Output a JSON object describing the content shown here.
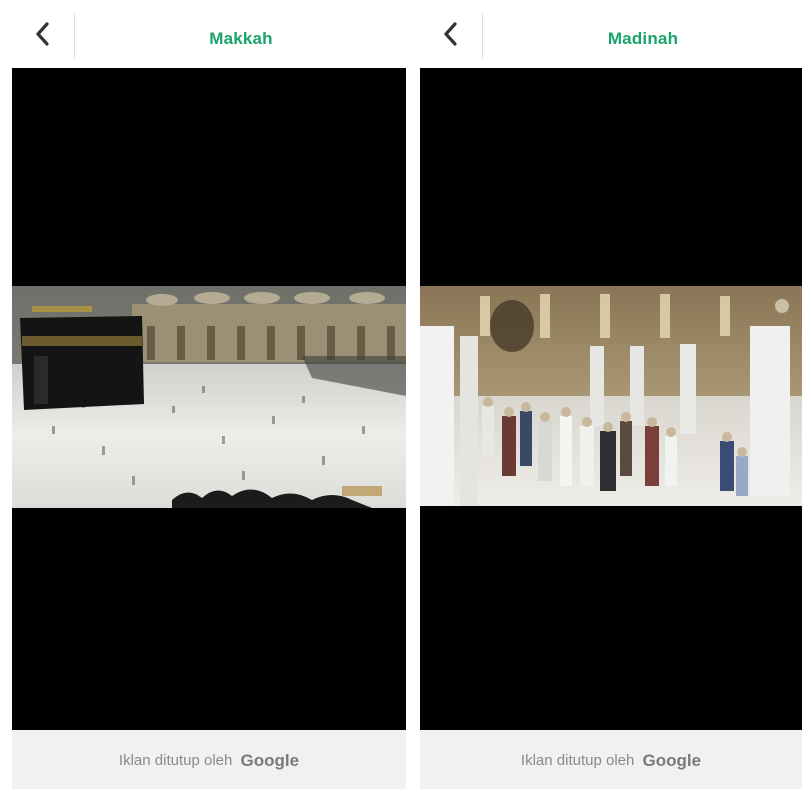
{
  "screens": [
    {
      "title": "Makkah",
      "back_icon": "chevron-left-icon",
      "video_scene": "kaaba-crowd",
      "ad_text": "Iklan ditutup oleh",
      "ad_brand": "Google"
    },
    {
      "title": "Madinah",
      "back_icon": "chevron-left-icon",
      "video_scene": "mosque-corridor",
      "ad_text": "Iklan ditutup oleh",
      "ad_brand": "Google"
    }
  ],
  "colors": {
    "title": "#1aa36b",
    "video_background": "#000000",
    "ad_background": "#f1f1f1",
    "ad_text": "#8a8a8a"
  }
}
